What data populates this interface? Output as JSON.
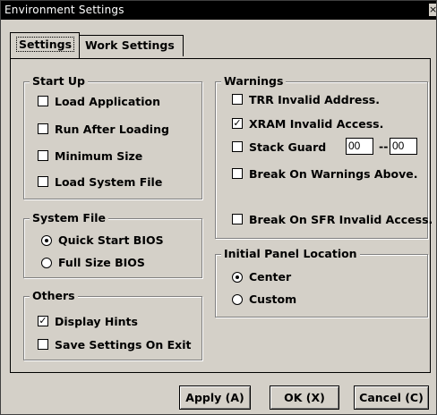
{
  "window": {
    "title": "Environment Settings",
    "close_glyph": "×"
  },
  "tabs": [
    {
      "label": "Settings",
      "active": true
    },
    {
      "label": "Work Settings",
      "active": false
    }
  ],
  "startup": {
    "title": "Start Up",
    "items": [
      {
        "label": "Load Application",
        "checked": false
      },
      {
        "label": "Run After Loading",
        "checked": false
      },
      {
        "label": "Minimum Size",
        "checked": false
      },
      {
        "label": "Load System File",
        "checked": false
      }
    ]
  },
  "system_file": {
    "title": "System File",
    "options": [
      {
        "label": "Quick Start BIOS",
        "selected": true
      },
      {
        "label": "Full Size BIOS",
        "selected": false
      }
    ]
  },
  "others": {
    "title": "Others",
    "items": [
      {
        "label": "Display Hints",
        "checked": true
      },
      {
        "label": "Save Settings On Exit",
        "checked": false
      }
    ]
  },
  "warnings": {
    "title": "Warnings",
    "items": [
      {
        "label": "TRR Invalid Address.",
        "checked": false
      },
      {
        "label": "XRAM Invalid Access.",
        "checked": true
      },
      {
        "label": "Stack Guard",
        "checked": false
      },
      {
        "label": "Break On Warnings Above.",
        "checked": false
      },
      {
        "label": "Break On SFR Invalid Access.",
        "checked": false
      }
    ],
    "stack_guard": {
      "from": "00",
      "separator": "--",
      "to": "00"
    }
  },
  "panel_location": {
    "title": "Initial Panel Location",
    "options": [
      {
        "label": "Center",
        "selected": true
      },
      {
        "label": "Custom",
        "selected": false
      }
    ]
  },
  "buttons": {
    "apply": "Apply (A)",
    "ok": "OK (X)",
    "cancel": "Cancel (C)"
  },
  "icons": {
    "checkbox_check": "check-mark-icon",
    "radio_dot": "radio-dot-icon"
  }
}
